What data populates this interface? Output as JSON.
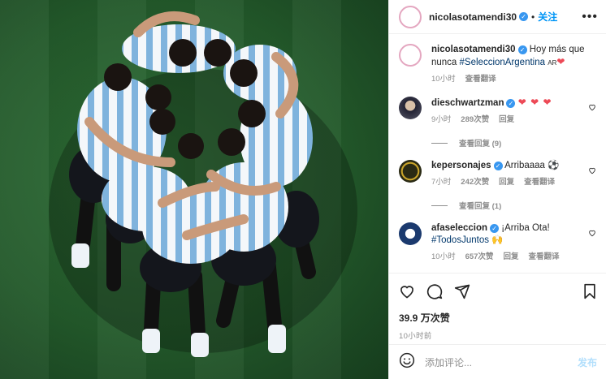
{
  "photo": {
    "alt": "Argentina players huddle"
  },
  "header": {
    "username": "nicolasotamendi30",
    "separator": "•",
    "follow_label": "关注",
    "more_icon": "more-icon"
  },
  "caption": {
    "username": "nicolasotamendi30",
    "text": "Hoy más que nunca ",
    "hashtag": "#SeleccionArgentina",
    "suffix": "AR",
    "emoji": "❤",
    "time": "10小时",
    "translate": "查看翻译"
  },
  "comments": [
    {
      "username": "dieschwartzman",
      "text": "❤ ❤ ❤",
      "time": "9小时",
      "likes": "289次赞",
      "reply": "回复",
      "replies": "查看回复 (9)",
      "translate": ""
    },
    {
      "username": "kepersonajes",
      "text": "Arribaaaa ⚽",
      "time": "7小时",
      "likes": "242次赞",
      "reply": "回复",
      "translate": "查看翻译",
      "replies": "查看回复 (1)"
    },
    {
      "username": "afaseleccion",
      "text": "¡Arriba Ota! ",
      "hashtag": "#TodosJuntos",
      "emoji": "🙌",
      "time": "10小时",
      "likes": "657次赞",
      "reply": "回复",
      "translate": "查看翻译"
    }
  ],
  "footer": {
    "likes": "39.9 万次赞",
    "time": "10小时前",
    "comment_placeholder": "添加评论...",
    "post_label": "发布"
  },
  "colors": {
    "accent": "#0095f6",
    "verified": "#3897f0",
    "heart": "#ed4956"
  }
}
